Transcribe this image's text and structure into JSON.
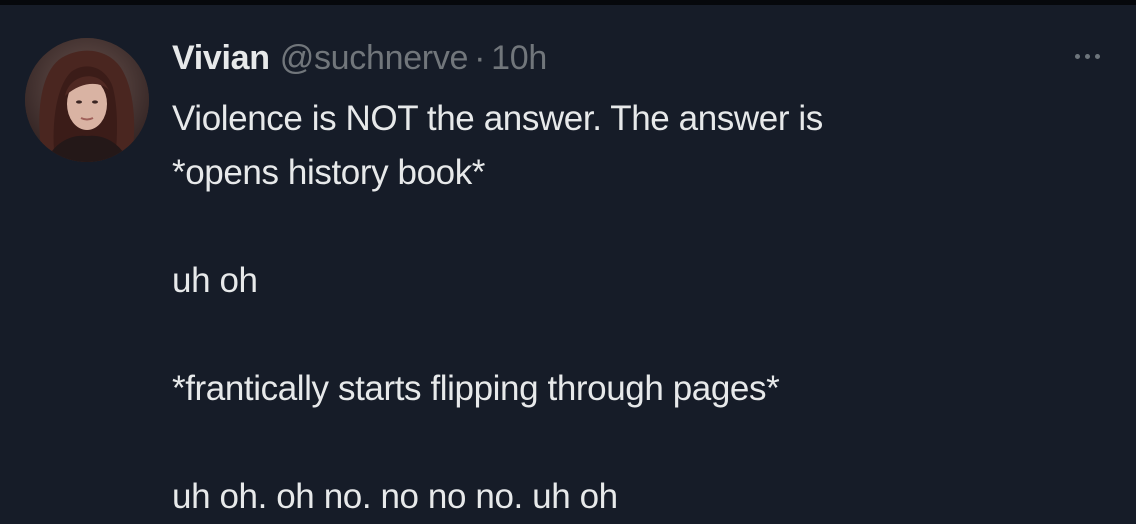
{
  "tweet": {
    "author": {
      "display_name": "Vivian",
      "handle": "@suchnerve",
      "separator": "·",
      "timestamp": "10h"
    },
    "more_icon": "more-horizontal-icon",
    "text_lines": [
      "Violence is NOT the answer. The answer is",
      "*opens history book*",
      "",
      "uh oh",
      "",
      "*frantically starts flipping through pages*",
      "",
      "uh oh. oh no. no no no. uh oh"
    ]
  },
  "colors": {
    "background": "#161c28",
    "text_primary": "#e7e9ea",
    "text_secondary": "#71767b"
  }
}
